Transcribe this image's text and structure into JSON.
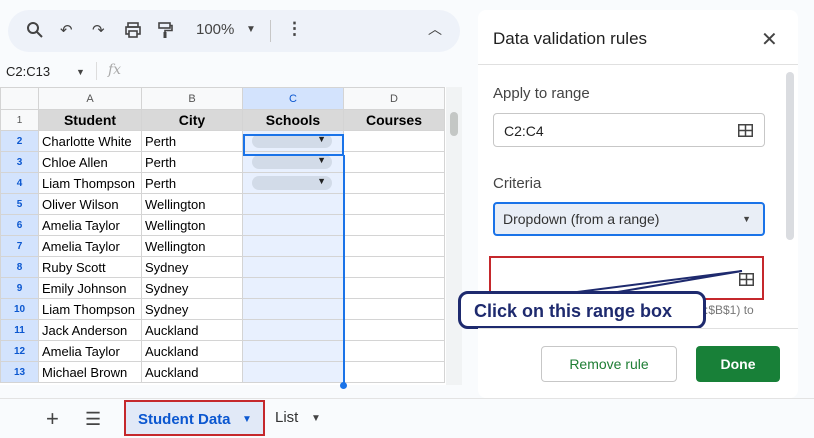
{
  "toolbar": {
    "zoom": "100%"
  },
  "formula_bar": {
    "name_box": "C2:C13",
    "fx": "fx"
  },
  "columns": [
    "A",
    "B",
    "C",
    "D"
  ],
  "header_row": {
    "num": "1",
    "cells": [
      "Student",
      "City",
      "Schools",
      "Courses"
    ]
  },
  "rows": [
    {
      "num": "2",
      "student": "Charlotte White",
      "city": "Perth"
    },
    {
      "num": "3",
      "student": "Chloe Allen",
      "city": "Perth"
    },
    {
      "num": "4",
      "student": "Liam Thompson",
      "city": "Perth"
    },
    {
      "num": "5",
      "student": "Oliver Wilson",
      "city": "Wellington"
    },
    {
      "num": "6",
      "student": "Amelia Taylor",
      "city": "Wellington"
    },
    {
      "num": "7",
      "student": "Amelia Taylor",
      "city": "Wellington"
    },
    {
      "num": "8",
      "student": "Ruby Scott",
      "city": "Sydney"
    },
    {
      "num": "9",
      "student": "Emily Johnson",
      "city": "Sydney"
    },
    {
      "num": "10",
      "student": "Liam Thompson",
      "city": "Sydney"
    },
    {
      "num": "11",
      "student": "Jack Anderson",
      "city": "Auckland"
    },
    {
      "num": "12",
      "student": "Amelia Taylor",
      "city": "Auckland"
    },
    {
      "num": "13",
      "student": "Michael Brown",
      "city": "Auckland"
    }
  ],
  "sheets": {
    "active": "Student Data",
    "other": "List"
  },
  "panel": {
    "title": "Data validation rules",
    "apply_label": "Apply to range",
    "apply_value": "C2:C4",
    "criteria_label": "Criteria",
    "criteria_value": "Dropdown (from a range)",
    "hint_fragment": ":$B$1) to",
    "remove_label": "Remove rule",
    "done_label": "Done"
  },
  "callout": {
    "text": "Click on this range box"
  },
  "colors": {
    "accent": "#1a73e8",
    "highlight": "#c5282c",
    "callout": "#1e2a6e",
    "done": "#188038"
  }
}
